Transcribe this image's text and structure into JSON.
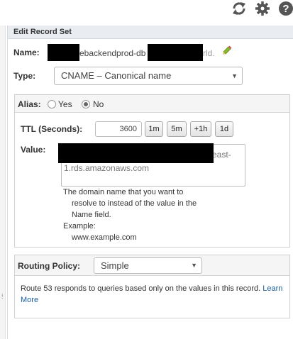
{
  "toolbar": {
    "refresh_icon": "refresh-icon",
    "settings_icon": "gear-icon",
    "help_icon": "help-icon"
  },
  "panel": {
    "title": "Edit Record Set"
  },
  "name": {
    "label": "Name:",
    "visible_middle": "ebackendprod-db",
    "visible_suffix": "rld.",
    "edit_icon": "pencil-icon"
  },
  "type": {
    "label": "Type:",
    "selected": "CNAME – Canonical name"
  },
  "alias": {
    "label": "Alias:",
    "yes_label": "Yes",
    "no_label": "No",
    "selected": "No"
  },
  "ttl": {
    "label": "TTL (Seconds):",
    "value": "3600",
    "buttons": [
      "1m",
      "5m",
      "+1h",
      "1d"
    ]
  },
  "value": {
    "label": "Value:",
    "line1_visible": "east-",
    "line2": "1.rds.amazonaws.com"
  },
  "help": {
    "line1": "The domain name that you want to",
    "line2": "resolve to instead of the value in the",
    "line3": "Name field.",
    "example_label": "Example:",
    "example_value": "www.example.com"
  },
  "routing": {
    "label": "Routing Policy:",
    "selected": "Simple",
    "description": "Route 53 responds to queries based only on the values in this record.",
    "learn_more_word1": "Learn",
    "learn_more_word2": "More"
  },
  "colors": {
    "header_bg": "#e9edf2",
    "link": "#1a5d9a",
    "icon": "#555555"
  }
}
